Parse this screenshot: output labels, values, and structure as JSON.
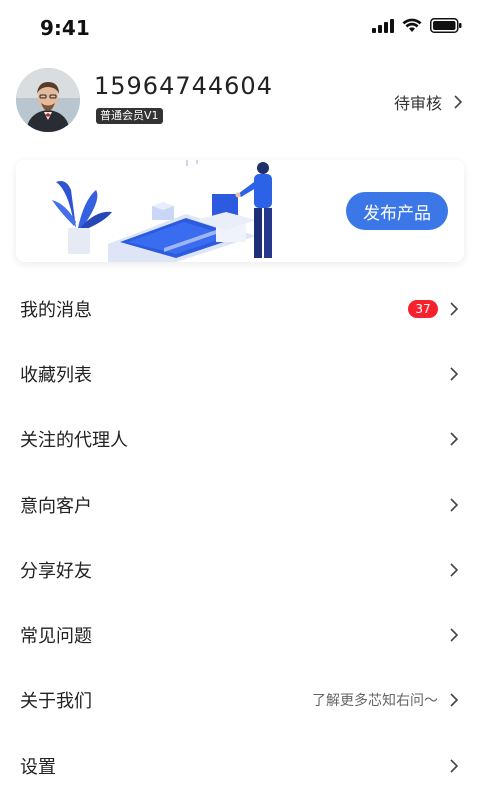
{
  "status_bar": {
    "time": "9:41"
  },
  "profile": {
    "phone": "15964744604",
    "member_level": "普通会员V1",
    "review_status": "待审核"
  },
  "banner": {
    "publish_button": "发布产品",
    "accent_color": "#3c77e8"
  },
  "menu": [
    {
      "label": "我的消息",
      "badge": "37",
      "hint": ""
    },
    {
      "label": "收藏列表",
      "badge": "",
      "hint": ""
    },
    {
      "label": "关注的代理人",
      "badge": "",
      "hint": ""
    },
    {
      "label": "意向客户",
      "badge": "",
      "hint": ""
    },
    {
      "label": "分享好友",
      "badge": "",
      "hint": ""
    },
    {
      "label": "常见问题",
      "badge": "",
      "hint": ""
    },
    {
      "label": "关于我们",
      "badge": "",
      "hint": "了解更多芯知右问～"
    },
    {
      "label": "设置",
      "badge": "",
      "hint": ""
    }
  ]
}
